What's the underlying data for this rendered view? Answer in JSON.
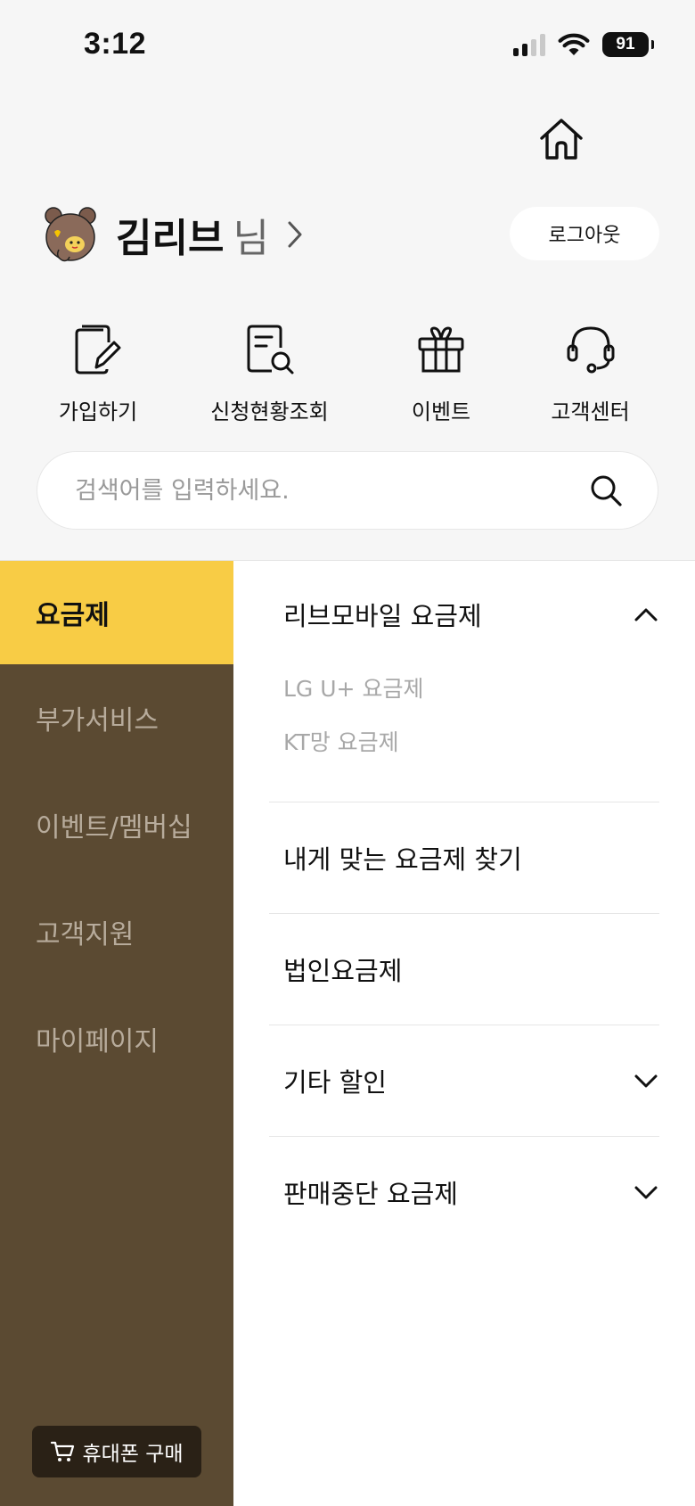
{
  "status_bar": {
    "time": "3:12",
    "battery": "91",
    "signal_bars_active": 2,
    "signal_bars_total": 4
  },
  "header": {
    "home_icon": "home-icon",
    "user": {
      "name": "김리브",
      "suffix": "님"
    },
    "logout_label": "로그아웃"
  },
  "quick_menu": [
    {
      "label": "가입하기",
      "icon": "signup-pencil-icon"
    },
    {
      "label": "신청현황조회",
      "icon": "document-search-icon"
    },
    {
      "label": "이벤트",
      "icon": "gift-icon"
    },
    {
      "label": "고객센터",
      "icon": "headset-icon"
    }
  ],
  "search": {
    "placeholder": "검색어를 입력하세요.",
    "value": ""
  },
  "left_nav": {
    "items": [
      {
        "label": "요금제",
        "active": true
      },
      {
        "label": "부가서비스",
        "active": false
      },
      {
        "label": "이벤트/멤버십",
        "active": false
      },
      {
        "label": "고객지원",
        "active": false
      },
      {
        "label": "마이페이지",
        "active": false
      }
    ],
    "buy_phone_label": "휴대폰 구매"
  },
  "right_panel": {
    "groups": [
      {
        "title": "리브모바일 요금제",
        "expanded": true,
        "chevron": "chevron-up-icon",
        "sub_items": [
          "LG U+ 요금제",
          "KT망 요금제"
        ]
      },
      {
        "title": "내게 맞는 요금제 찾기",
        "expanded": false,
        "chevron": null
      },
      {
        "title": "법인요금제",
        "expanded": false,
        "chevron": null
      },
      {
        "title": "기타 할인",
        "expanded": false,
        "chevron": "chevron-down-icon"
      },
      {
        "title": "판매중단 요금제",
        "expanded": false,
        "chevron": "chevron-down-icon"
      }
    ]
  },
  "colors": {
    "accent_yellow": "#f8cc45",
    "nav_brown": "#5b4a32",
    "nav_text": "#b7ab9b",
    "buy_button": "#2a2116",
    "background": "#f6f6f6"
  }
}
